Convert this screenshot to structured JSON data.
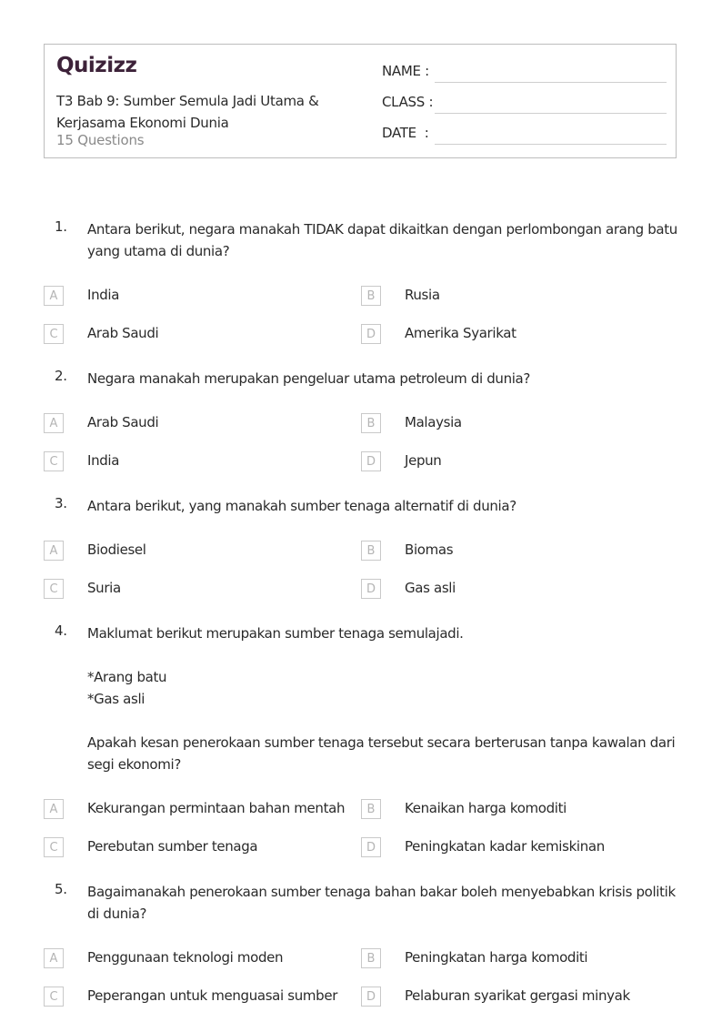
{
  "header": {
    "logo": "Quizizz",
    "title": "T3 Bab 9: Sumber Semula Jadi Utama & Kerjasama Ekonomi Dunia",
    "question_count": "15 Questions",
    "fields": [
      {
        "label": "NAME :"
      },
      {
        "label": "CLASS :"
      },
      {
        "label": "DATE  :"
      }
    ]
  },
  "questions": [
    {
      "number": "1.",
      "text": "Antara berikut, negara manakah TIDAK dapat dikaitkan dengan perlombongan arang batu yang utama di dunia?",
      "options": [
        {
          "letter": "A",
          "text": "India"
        },
        {
          "letter": "B",
          "text": "Rusia"
        },
        {
          "letter": "C",
          "text": "Arab Saudi"
        },
        {
          "letter": "D",
          "text": "Amerika Syarikat"
        }
      ]
    },
    {
      "number": "2.",
      "text": "Negara manakah merupakan pengeluar utama petroleum di dunia?",
      "options": [
        {
          "letter": "A",
          "text": "Arab Saudi"
        },
        {
          "letter": "B",
          "text": "Malaysia"
        },
        {
          "letter": "C",
          "text": "India"
        },
        {
          "letter": "D",
          "text": "Jepun"
        }
      ]
    },
    {
      "number": "3.",
      "text": "Antara berikut, yang manakah sumber tenaga alternatif di dunia?",
      "options": [
        {
          "letter": "A",
          "text": "Biodiesel"
        },
        {
          "letter": "B",
          "text": "Biomas"
        },
        {
          "letter": "C",
          "text": "Suria"
        },
        {
          "letter": "D",
          "text": "Gas asli"
        }
      ]
    },
    {
      "number": "4.",
      "text": "Maklumat berikut merupakan sumber tenaga semulajadi.\n\n*Arang batu\n*Gas asli\n\nApakah kesan penerokaan sumber tenaga tersebut secara berterusan tanpa kawalan dari segi ekonomi?",
      "options": [
        {
          "letter": "A",
          "text": "Kekurangan permintaan bahan mentah"
        },
        {
          "letter": "B",
          "text": "Kenaikan harga komoditi"
        },
        {
          "letter": "C",
          "text": "Perebutan sumber tenaga"
        },
        {
          "letter": "D",
          "text": "Peningkatan kadar kemiskinan"
        }
      ]
    },
    {
      "number": "5.",
      "text": "Bagaimanakah penerokaan sumber tenaga bahan bakar boleh menyebabkan krisis politik di dunia?",
      "options": [
        {
          "letter": "A",
          "text": "Penggunaan teknologi moden"
        },
        {
          "letter": "B",
          "text": "Peningkatan harga komoditi"
        },
        {
          "letter": "C",
          "text": "Peperangan untuk menguasai sumber"
        },
        {
          "letter": "D",
          "text": "Pelaburan syarikat gergasi minyak"
        }
      ]
    }
  ]
}
